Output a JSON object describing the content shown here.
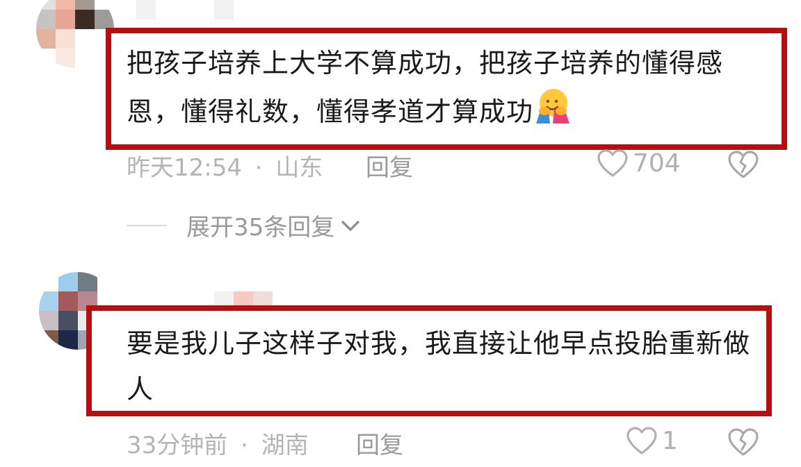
{
  "comments": [
    {
      "text": "把孩子培养上大学不算成功，把孩子培养的懂得感恩，懂得礼数，懂得孝道才算成功",
      "emoji": "hugging-face-icon",
      "time": "昨天12:54",
      "separator": "·",
      "location": "山东",
      "reply_label": "回复",
      "likes": "704",
      "expand_label": "展开35条回复"
    },
    {
      "text": "要是我儿子这样子对我，我直接让他早点投胎重新做人",
      "time": "33分钟前",
      "separator": "·",
      "location": "湖南",
      "reply_label": "回复",
      "likes": "1"
    }
  ],
  "colors": {
    "highlight_border": "#b2110f",
    "meta_text": "#b4b4b4",
    "body_text": "#1a1a1a"
  }
}
